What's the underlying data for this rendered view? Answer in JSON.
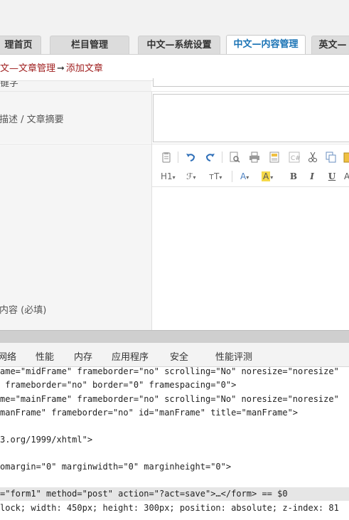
{
  "nav_tabs": [
    {
      "label": "理首页",
      "active": false
    },
    {
      "label": "栏目管理",
      "active": false
    },
    {
      "label": "中文—系统设置",
      "active": false
    },
    {
      "label": "中文—内容管理",
      "active": true
    },
    {
      "label": "英文—",
      "active": false
    }
  ],
  "breadcrumb": {
    "part1": "文—文章管理",
    "arrow": "➞",
    "part2": "添加文章"
  },
  "form": {
    "keywords_label": "关键字",
    "summary_label": "描述 / 文章摘要",
    "content_label": "内容 (必填)"
  },
  "editor_toolbar": {
    "row1": [
      "paste-icon",
      "undo-icon",
      "redo-icon",
      "preview-icon",
      "print-icon",
      "template-icon",
      "code-icon",
      "cut-icon",
      "copy-icon",
      "paste-more-icon"
    ],
    "heading": "H1",
    "font_family": "ℱ",
    "font_size": "тT",
    "font_color": "A",
    "highlight": "A",
    "bold": "B",
    "italic": "I",
    "underline": "U"
  },
  "devtools": {
    "tabs": [
      "网络",
      "性能",
      "内存",
      "应用程序",
      "安全",
      "性能评测"
    ],
    "lines": [
      {
        "text": "ame=\"midFrame\" frameborder=\"no\" scrolling=\"No\" noresize=\"noresize\""
      },
      {
        "text": " frameborder=\"no\" border=\"0\" framespacing=\"0\">"
      },
      {
        "text": "me=\"mainFrame\" frameborder=\"no\" scrolling=\"No\" noresize=\"noresize\""
      },
      {
        "text": "manFrame\" frameborder=\"no\" id=\"manFrame\" title=\"manFrame\">"
      },
      {
        "text": ""
      },
      {
        "text": "3.org/1999/xhtml\">"
      },
      {
        "text": ""
      },
      {
        "text": "omargin=\"0\" marginwidth=\"0\" marginheight=\"0\">"
      },
      {
        "text": ""
      },
      {
        "text": "=\"form1\" method=\"post\" action=\"?act=save\">…</form> == $0"
      },
      {
        "text": "lock; width: 450px; height: 300px; position: absolute; z-index: 81"
      }
    ]
  },
  "colors": {
    "active_tab_text": "#1a73b5",
    "breadcrumb_link": "#a02020",
    "label_bg": "#f5f5f5"
  }
}
